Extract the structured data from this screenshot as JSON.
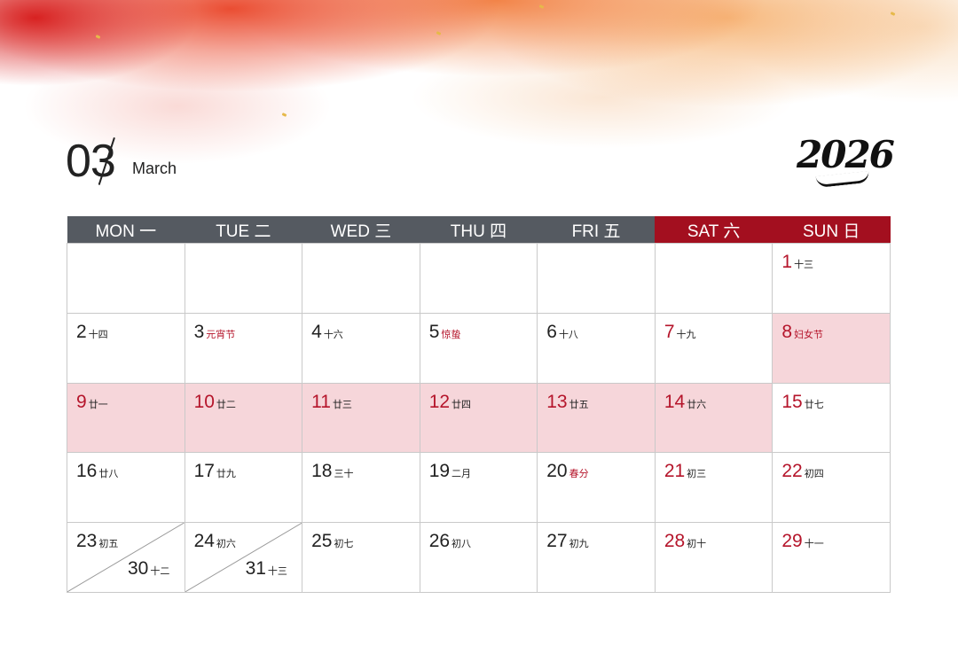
{
  "header": {
    "month_number": "03",
    "month_name": "March",
    "year": "2026"
  },
  "colors": {
    "header_weekday": "#555a61",
    "header_weekend": "#a30f1f",
    "highlight": "#f6d6da",
    "holiday_text": "#b5152b"
  },
  "weekdays": [
    {
      "label": "MON 一"
    },
    {
      "label": "TUE 二"
    },
    {
      "label": "WED 三"
    },
    {
      "label": "THU 四"
    },
    {
      "label": "FRI 五"
    },
    {
      "label": "SAT 六"
    },
    {
      "label": "SUN 日"
    }
  ],
  "weeks": [
    [
      {
        "day": "",
        "lunar": ""
      },
      {
        "day": "",
        "lunar": ""
      },
      {
        "day": "",
        "lunar": ""
      },
      {
        "day": "",
        "lunar": ""
      },
      {
        "day": "",
        "lunar": ""
      },
      {
        "day": "",
        "lunar": ""
      },
      {
        "day": "1",
        "lunar": "十三"
      }
    ],
    [
      {
        "day": "2",
        "lunar": "十四"
      },
      {
        "day": "3",
        "lunar": "元宵节"
      },
      {
        "day": "4",
        "lunar": "十六"
      },
      {
        "day": "5",
        "lunar": "惊蛰"
      },
      {
        "day": "6",
        "lunar": "十八"
      },
      {
        "day": "7",
        "lunar": "十九"
      },
      {
        "day": "8",
        "lunar": "妇女节"
      }
    ],
    [
      {
        "day": "9",
        "lunar": "廿一"
      },
      {
        "day": "10",
        "lunar": "廿二"
      },
      {
        "day": "11",
        "lunar": "廿三"
      },
      {
        "day": "12",
        "lunar": "廿四"
      },
      {
        "day": "13",
        "lunar": "廿五"
      },
      {
        "day": "14",
        "lunar": "廿六"
      },
      {
        "day": "15",
        "lunar": "廿七"
      }
    ],
    [
      {
        "day": "16",
        "lunar": "廿八"
      },
      {
        "day": "17",
        "lunar": "廿九"
      },
      {
        "day": "18",
        "lunar": "三十"
      },
      {
        "day": "19",
        "lunar": "二月"
      },
      {
        "day": "20",
        "lunar": "春分"
      },
      {
        "day": "21",
        "lunar": "初三"
      },
      {
        "day": "22",
        "lunar": "初四"
      }
    ],
    [
      {
        "day": "23",
        "lunar": "初五",
        "day2": "30",
        "lunar2": "十二"
      },
      {
        "day": "24",
        "lunar": "初六",
        "day2": "31",
        "lunar2": "十三"
      },
      {
        "day": "25",
        "lunar": "初七"
      },
      {
        "day": "26",
        "lunar": "初八"
      },
      {
        "day": "27",
        "lunar": "初九"
      },
      {
        "day": "28",
        "lunar": "初十"
      },
      {
        "day": "29",
        "lunar": "十一"
      }
    ]
  ]
}
